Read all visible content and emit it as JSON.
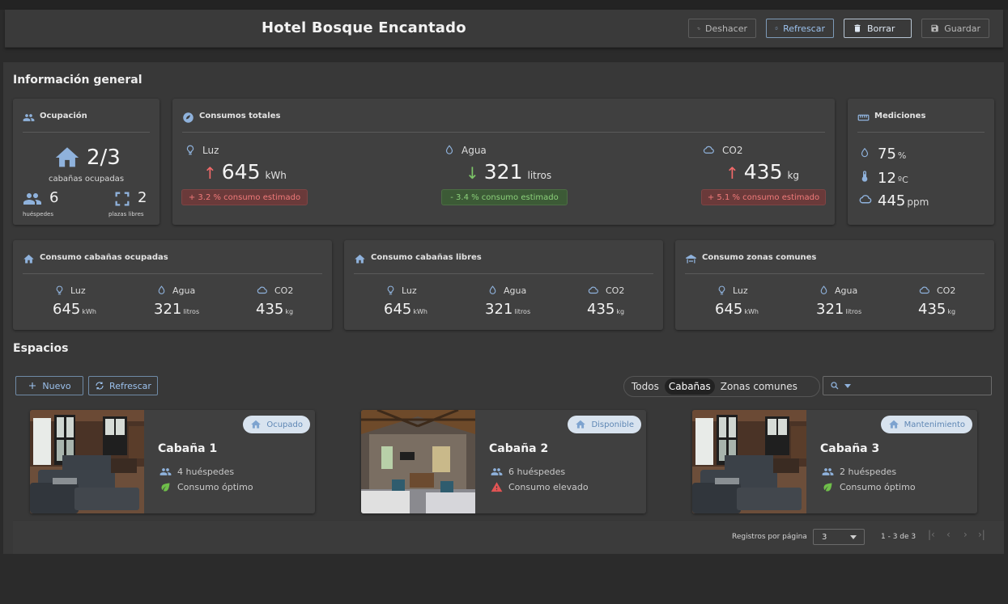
{
  "header": {
    "title": "Hotel Bosque Encantado",
    "buttons": {
      "undo": "Deshacer",
      "refresh": "Refrescar",
      "delete": "Borrar",
      "save": "Guardar"
    }
  },
  "general": {
    "title": "Información general",
    "occupancy": {
      "title": "Ocupación",
      "ratio": "2/3",
      "ratio_label": "cabañas ocupadas",
      "guests": "6",
      "guests_label": "huéspedes",
      "free": "2",
      "free_label": "plazas libres"
    },
    "totals": {
      "title": "Consumos totales",
      "light": {
        "label": "Luz",
        "value": "645",
        "unit": "kWh",
        "arrow": "↑",
        "badge": "+ 3.2 % consumo estimado"
      },
      "water": {
        "label": "Agua",
        "value": "321",
        "unit": "litros",
        "arrow": "↓",
        "badge": "- 3.4 % consumo estimado"
      },
      "co2": {
        "label": "CO2",
        "value": "435",
        "unit": "kg",
        "arrow": "↑",
        "badge": "+ 5.1 % consumo estimado"
      }
    },
    "measures": {
      "title": "Mediciones",
      "humidity": {
        "value": "75",
        "unit": "%"
      },
      "temperature": {
        "value": "12",
        "unit": "ºC"
      },
      "co2": {
        "value": "445",
        "unit": "ppm"
      }
    },
    "sub_cards": [
      {
        "title": "Consumo cabañas ocupadas",
        "light_label": "Luz",
        "light_value": "645",
        "light_unit": "kWh",
        "water_label": "Agua",
        "water_value": "321",
        "water_unit": "litros",
        "co2_label": "CO2",
        "co2_value": "435",
        "co2_unit": "kg"
      },
      {
        "title": "Consumo cabañas libres",
        "light_label": "Luz",
        "light_value": "645",
        "light_unit": "kWh",
        "water_label": "Agua",
        "water_value": "321",
        "water_unit": "litros",
        "co2_label": "CO2",
        "co2_value": "435",
        "co2_unit": "kg"
      },
      {
        "title": "Consumo zonas comunes",
        "light_label": "Luz",
        "light_value": "645",
        "light_unit": "kWh",
        "water_label": "Agua",
        "water_value": "321",
        "water_unit": "litros",
        "co2_label": "CO2",
        "co2_value": "435",
        "co2_unit": "kg"
      }
    ]
  },
  "spaces": {
    "title": "Espacios",
    "new_label": "Nuevo",
    "refresh_label": "Refrescar",
    "filters": [
      "Todos",
      "Cabañas",
      "Zonas comunes"
    ],
    "active_filter": "Cabañas",
    "cards": [
      {
        "name": "Cabaña 1",
        "status": "Ocupado",
        "guests": "4 huéspedes",
        "consumption": "Consumo óptimo",
        "consumption_state": "ok"
      },
      {
        "name": "Cabaña 2",
        "status": "Disponible",
        "guests": "6 huéspedes",
        "consumption": "Consumo elevado",
        "consumption_state": "warning"
      },
      {
        "name": "Cabaña 3",
        "status": "Mantenimiento",
        "guests": "2 huéspedes",
        "consumption": "Consumo óptimo",
        "consumption_state": "ok"
      }
    ]
  },
  "pagination": {
    "rows_label": "Registros por página",
    "rows_value": "3",
    "range": "1 - 3 de 3"
  },
  "colors": {
    "accent": "#8fb2dc",
    "up": "#f26a6a",
    "down": "#7cc568",
    "ok": "#6fbf4a",
    "warning": "#e25454"
  }
}
